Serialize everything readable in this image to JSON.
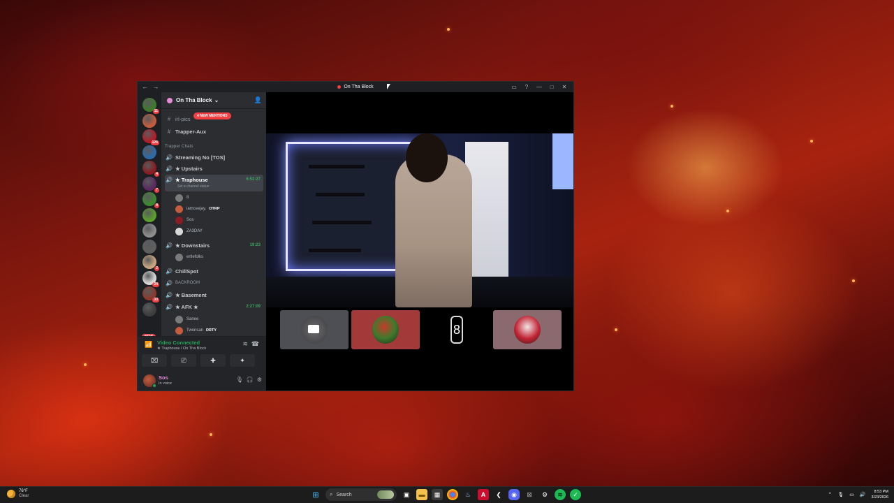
{
  "window": {
    "title": "On Tha Block",
    "nav_back": "←",
    "nav_forward": "→",
    "controls": [
      "▭",
      "?",
      "—",
      "□",
      "✕"
    ]
  },
  "servers": [
    {
      "badge": "11"
    },
    {
      "badge": ""
    },
    {
      "badge": "126"
    },
    {
      "badge": ""
    },
    {
      "badge": "4"
    },
    {
      "badge": "7"
    },
    {
      "badge": "8"
    },
    {
      "badge": ""
    },
    {
      "badge": ""
    },
    {
      "badge": ""
    },
    {
      "badge": "2"
    },
    {
      "badge": "24"
    },
    {
      "badge": "33"
    },
    {
      "badge": ""
    }
  ],
  "server_new_label": "NEW",
  "guild": {
    "name": "On Tha Block",
    "chevron": "⌄",
    "new_mentions": "4 NEW MENTIONS"
  },
  "channels": {
    "irl_pics": "irl-pics",
    "trapper_aux": "Trapper-Aux",
    "category": "Trapper Chats",
    "streaming": "Streaming No [TOS]",
    "upstairs": "★ Upstairs",
    "traphouse": "★ Traphouse",
    "traphouse_time": "6:52:27",
    "traphouse_status": "Set a channel status",
    "downstairs": "★ Downstairs",
    "downstairs_time": "19:23",
    "chillspot": "ChillSpot",
    "backroom": "BACKROOM",
    "basement": "★ Basement",
    "afk": "★ AFK ★",
    "afk_time": "2:27:09"
  },
  "voice_users": {
    "traphouse": [
      {
        "name": "8",
        "tag": ""
      },
      {
        "name": "iamceejay.",
        "tag": "OTRP"
      },
      {
        "name": "Sos",
        "tag": ""
      },
      {
        "name": "ZA3DAY",
        "tag": ""
      }
    ],
    "downstairs": [
      {
        "name": "ertlefolks",
        "tag": ""
      }
    ],
    "afk": [
      {
        "name": "Sanee",
        "tag": ""
      },
      {
        "name": "Twonsan",
        "tag": "DRTY"
      }
    ]
  },
  "voice_panel": {
    "status": "Video Connected",
    "location": "★ Traphouse / On Tha Block"
  },
  "user_panel": {
    "name": "Sos",
    "state": "In voice"
  },
  "taskbar": {
    "temperature": "76°F",
    "condition": "Clear",
    "search_placeholder": "Search",
    "time": "8:53 PM",
    "date": "3/23/2026"
  },
  "colors": {
    "discord_green": "#23a55a",
    "mention_red": "#f23f43",
    "sidebar_bg": "#2b2d31",
    "username_pink": "#e48ad9"
  }
}
